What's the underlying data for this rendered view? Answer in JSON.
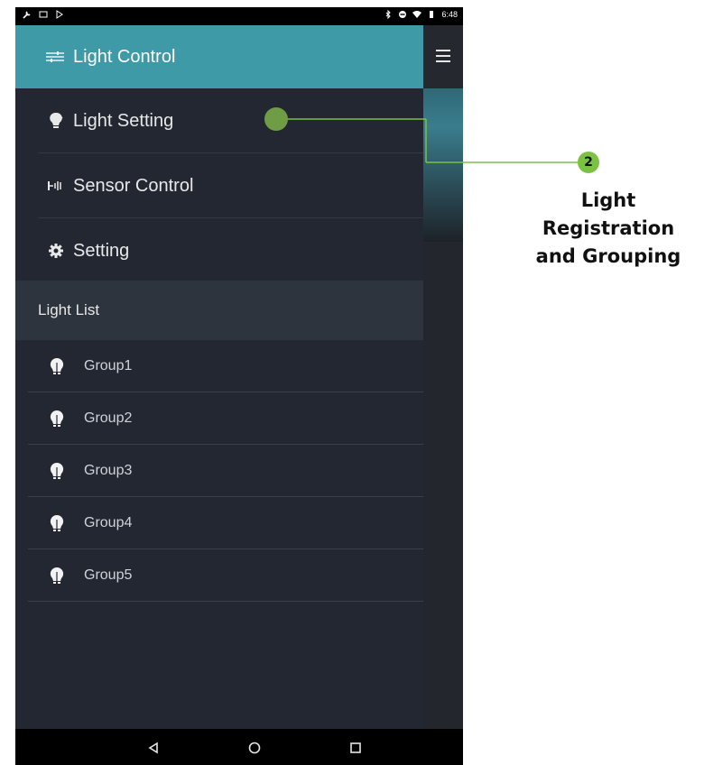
{
  "status_bar": {
    "time": "6:48",
    "left_icons": [
      "wrench-icon",
      "notification-icon",
      "play-store-icon"
    ],
    "right_icons": [
      "bluetooth-icon",
      "do-not-disturb-icon",
      "wifi-icon",
      "battery-icon"
    ]
  },
  "drawer": {
    "header_title": "Light Control",
    "header_icon": "sliders-icon",
    "nav_items": [
      {
        "label": "Light Setting",
        "icon": "bulb-icon"
      },
      {
        "label": "Sensor Control",
        "icon": "sensor-icon"
      },
      {
        "label": "Setting",
        "icon": "gear-icon"
      }
    ],
    "list_header": "Light List",
    "groups": [
      {
        "label": "Group1",
        "icon": "bulb-group-icon"
      },
      {
        "label": "Group2",
        "icon": "bulb-group-icon"
      },
      {
        "label": "Group3",
        "icon": "bulb-group-icon"
      },
      {
        "label": "Group4",
        "icon": "bulb-group-icon"
      },
      {
        "label": "Group5",
        "icon": "bulb-group-icon"
      }
    ]
  },
  "app_bar": {
    "menu_icon": "hamburger-icon"
  },
  "navigation_bar": {
    "buttons": [
      "back-icon",
      "home-icon",
      "recents-icon"
    ]
  },
  "callout": {
    "number": "2",
    "lines": [
      "Light",
      "Registration",
      "and Grouping"
    ],
    "color": "#7bc143"
  },
  "colors": {
    "header": "#3f9aa8",
    "drawer_bg": "#222731",
    "list_header_bg": "#2e343e"
  }
}
